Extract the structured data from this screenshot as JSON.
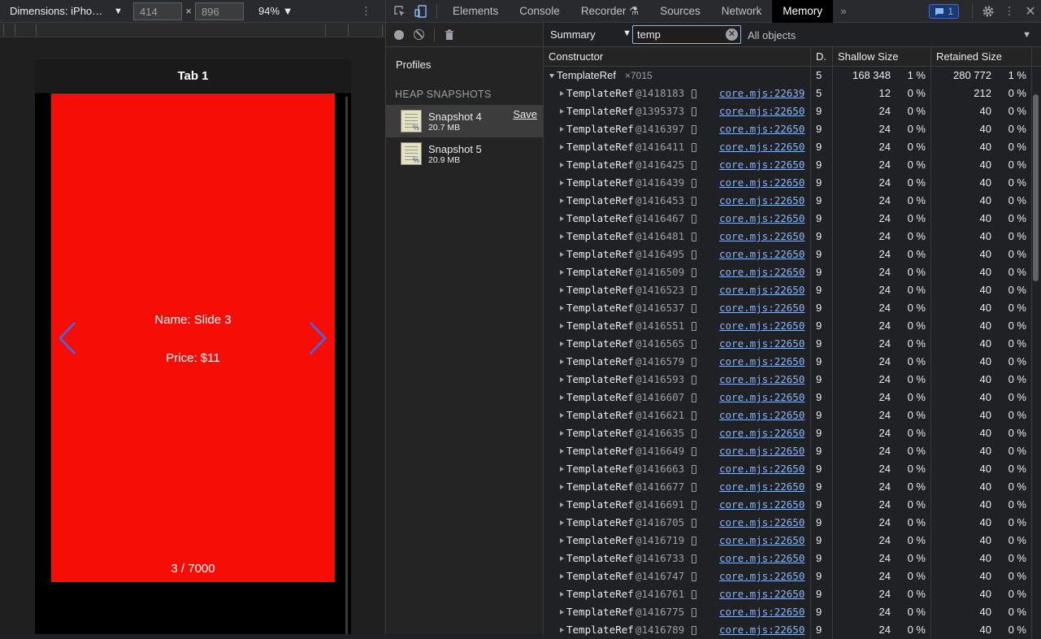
{
  "device_toolbar": {
    "dimensions_label": "Dimensions: iPho…",
    "width": "414",
    "times": "×",
    "height": "896",
    "zoom": "94%"
  },
  "phone": {
    "tab_title": "Tab 1",
    "slide_name": "Name: Slide 3",
    "slide_price": "Price: $11",
    "pager": "3 / 7000",
    "slide_color": "#f60e06",
    "arrow_color": "#3b6cf6"
  },
  "devtools": {
    "tabs": [
      "Elements",
      "Console",
      "Recorder",
      "Sources",
      "Network",
      "Memory"
    ],
    "active_tab": "Memory",
    "issues_count": "1"
  },
  "profiles": {
    "title": "Profiles",
    "section": "HEAP SNAPSHOTS",
    "snapshots": [
      {
        "name": "Snapshot 4",
        "size": "20.7 MB",
        "save": "Save"
      },
      {
        "name": "Snapshot 5",
        "size": "20.9 MB"
      }
    ]
  },
  "summary": {
    "view": "Summary",
    "filter": "temp",
    "objects": "All objects",
    "columns": [
      "Constructor",
      "D.",
      "Shallow Size",
      "Retained Size"
    ],
    "group": {
      "name": "TemplateRef",
      "count": "×7015",
      "distance": "5",
      "shallow": "168 348",
      "shallow_pct": "1 %",
      "retained": "280 772",
      "retained_pct": "1 %"
    },
    "rows": [
      {
        "name": "TemplateRef",
        "id": "@1418183",
        "link": "core.mjs:22639",
        "d": "5",
        "sh": "12",
        "shp": "0 %",
        "rt": "212",
        "rtp": "0 %"
      },
      {
        "name": "TemplateRef",
        "id": "@1395373",
        "link": "core.mjs:22650",
        "d": "9",
        "sh": "24",
        "shp": "0 %",
        "rt": "40",
        "rtp": "0 %"
      },
      {
        "name": "TemplateRef",
        "id": "@1416397",
        "link": "core.mjs:22650",
        "d": "9",
        "sh": "24",
        "shp": "0 %",
        "rt": "40",
        "rtp": "0 %"
      },
      {
        "name": "TemplateRef",
        "id": "@1416411",
        "link": "core.mjs:22650",
        "d": "9",
        "sh": "24",
        "shp": "0 %",
        "rt": "40",
        "rtp": "0 %"
      },
      {
        "name": "TemplateRef",
        "id": "@1416425",
        "link": "core.mjs:22650",
        "d": "9",
        "sh": "24",
        "shp": "0 %",
        "rt": "40",
        "rtp": "0 %"
      },
      {
        "name": "TemplateRef",
        "id": "@1416439",
        "link": "core.mjs:22650",
        "d": "9",
        "sh": "24",
        "shp": "0 %",
        "rt": "40",
        "rtp": "0 %"
      },
      {
        "name": "TemplateRef",
        "id": "@1416453",
        "link": "core.mjs:22650",
        "d": "9",
        "sh": "24",
        "shp": "0 %",
        "rt": "40",
        "rtp": "0 %"
      },
      {
        "name": "TemplateRef",
        "id": "@1416467",
        "link": "core.mjs:22650",
        "d": "9",
        "sh": "24",
        "shp": "0 %",
        "rt": "40",
        "rtp": "0 %"
      },
      {
        "name": "TemplateRef",
        "id": "@1416481",
        "link": "core.mjs:22650",
        "d": "9",
        "sh": "24",
        "shp": "0 %",
        "rt": "40",
        "rtp": "0 %"
      },
      {
        "name": "TemplateRef",
        "id": "@1416495",
        "link": "core.mjs:22650",
        "d": "9",
        "sh": "24",
        "shp": "0 %",
        "rt": "40",
        "rtp": "0 %"
      },
      {
        "name": "TemplateRef",
        "id": "@1416509",
        "link": "core.mjs:22650",
        "d": "9",
        "sh": "24",
        "shp": "0 %",
        "rt": "40",
        "rtp": "0 %"
      },
      {
        "name": "TemplateRef",
        "id": "@1416523",
        "link": "core.mjs:22650",
        "d": "9",
        "sh": "24",
        "shp": "0 %",
        "rt": "40",
        "rtp": "0 %"
      },
      {
        "name": "TemplateRef",
        "id": "@1416537",
        "link": "core.mjs:22650",
        "d": "9",
        "sh": "24",
        "shp": "0 %",
        "rt": "40",
        "rtp": "0 %"
      },
      {
        "name": "TemplateRef",
        "id": "@1416551",
        "link": "core.mjs:22650",
        "d": "9",
        "sh": "24",
        "shp": "0 %",
        "rt": "40",
        "rtp": "0 %"
      },
      {
        "name": "TemplateRef",
        "id": "@1416565",
        "link": "core.mjs:22650",
        "d": "9",
        "sh": "24",
        "shp": "0 %",
        "rt": "40",
        "rtp": "0 %"
      },
      {
        "name": "TemplateRef",
        "id": "@1416579",
        "link": "core.mjs:22650",
        "d": "9",
        "sh": "24",
        "shp": "0 %",
        "rt": "40",
        "rtp": "0 %"
      },
      {
        "name": "TemplateRef",
        "id": "@1416593",
        "link": "core.mjs:22650",
        "d": "9",
        "sh": "24",
        "shp": "0 %",
        "rt": "40",
        "rtp": "0 %"
      },
      {
        "name": "TemplateRef",
        "id": "@1416607",
        "link": "core.mjs:22650",
        "d": "9",
        "sh": "24",
        "shp": "0 %",
        "rt": "40",
        "rtp": "0 %"
      },
      {
        "name": "TemplateRef",
        "id": "@1416621",
        "link": "core.mjs:22650",
        "d": "9",
        "sh": "24",
        "shp": "0 %",
        "rt": "40",
        "rtp": "0 %"
      },
      {
        "name": "TemplateRef",
        "id": "@1416635",
        "link": "core.mjs:22650",
        "d": "9",
        "sh": "24",
        "shp": "0 %",
        "rt": "40",
        "rtp": "0 %"
      },
      {
        "name": "TemplateRef",
        "id": "@1416649",
        "link": "core.mjs:22650",
        "d": "9",
        "sh": "24",
        "shp": "0 %",
        "rt": "40",
        "rtp": "0 %"
      },
      {
        "name": "TemplateRef",
        "id": "@1416663",
        "link": "core.mjs:22650",
        "d": "9",
        "sh": "24",
        "shp": "0 %",
        "rt": "40",
        "rtp": "0 %"
      },
      {
        "name": "TemplateRef",
        "id": "@1416677",
        "link": "core.mjs:22650",
        "d": "9",
        "sh": "24",
        "shp": "0 %",
        "rt": "40",
        "rtp": "0 %"
      },
      {
        "name": "TemplateRef",
        "id": "@1416691",
        "link": "core.mjs:22650",
        "d": "9",
        "sh": "24",
        "shp": "0 %",
        "rt": "40",
        "rtp": "0 %"
      },
      {
        "name": "TemplateRef",
        "id": "@1416705",
        "link": "core.mjs:22650",
        "d": "9",
        "sh": "24",
        "shp": "0 %",
        "rt": "40",
        "rtp": "0 %"
      },
      {
        "name": "TemplateRef",
        "id": "@1416719",
        "link": "core.mjs:22650",
        "d": "9",
        "sh": "24",
        "shp": "0 %",
        "rt": "40",
        "rtp": "0 %"
      },
      {
        "name": "TemplateRef",
        "id": "@1416733",
        "link": "core.mjs:22650",
        "d": "9",
        "sh": "24",
        "shp": "0 %",
        "rt": "40",
        "rtp": "0 %"
      },
      {
        "name": "TemplateRef",
        "id": "@1416747",
        "link": "core.mjs:22650",
        "d": "9",
        "sh": "24",
        "shp": "0 %",
        "rt": "40",
        "rtp": "0 %"
      },
      {
        "name": "TemplateRef",
        "id": "@1416761",
        "link": "core.mjs:22650",
        "d": "9",
        "sh": "24",
        "shp": "0 %",
        "rt": "40",
        "rtp": "0 %"
      },
      {
        "name": "TemplateRef",
        "id": "@1416775",
        "link": "core.mjs:22650",
        "d": "9",
        "sh": "24",
        "shp": "0 %",
        "rt": "40",
        "rtp": "0 %"
      },
      {
        "name": "TemplateRef",
        "id": "@1416789",
        "link": "core.mjs:22650",
        "d": "9",
        "sh": "24",
        "shp": "0 %",
        "rt": "40",
        "rtp": "0 %"
      }
    ]
  }
}
